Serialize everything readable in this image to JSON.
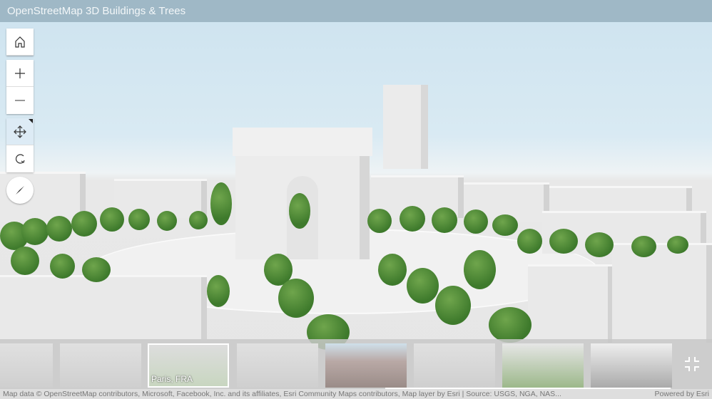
{
  "header": {
    "title": "OpenStreetMap 3D Buildings & Trees"
  },
  "tools": [
    {
      "name": "home",
      "icon": "home-icon"
    },
    {
      "name": "zoom-in",
      "icon": "plus-icon"
    },
    {
      "name": "zoom-out",
      "icon": "minus-icon"
    },
    {
      "name": "pan",
      "icon": "pan-icon",
      "active": true
    },
    {
      "name": "rotate",
      "icon": "rotate-icon"
    },
    {
      "name": "compass",
      "icon": "compass-icon"
    }
  ],
  "slides": [
    {
      "label": ""
    },
    {
      "label": ""
    },
    {
      "label": "Paris, FRA"
    },
    {
      "label": ""
    },
    {
      "label": ""
    },
    {
      "label": ""
    },
    {
      "label": ""
    },
    {
      "label": ""
    }
  ],
  "attribution": {
    "text": "Map data © OpenStreetMap contributors, Microsoft, Facebook, Inc. and its affiliates, Esri Community Maps contributors, Map layer by Esri | Source: USGS, NGA, NAS...",
    "powered": "Powered by Esri"
  },
  "colors": {
    "header": "#9fb8c6",
    "tree": "#3e7a2c",
    "active_tool": "#ddebf5"
  }
}
